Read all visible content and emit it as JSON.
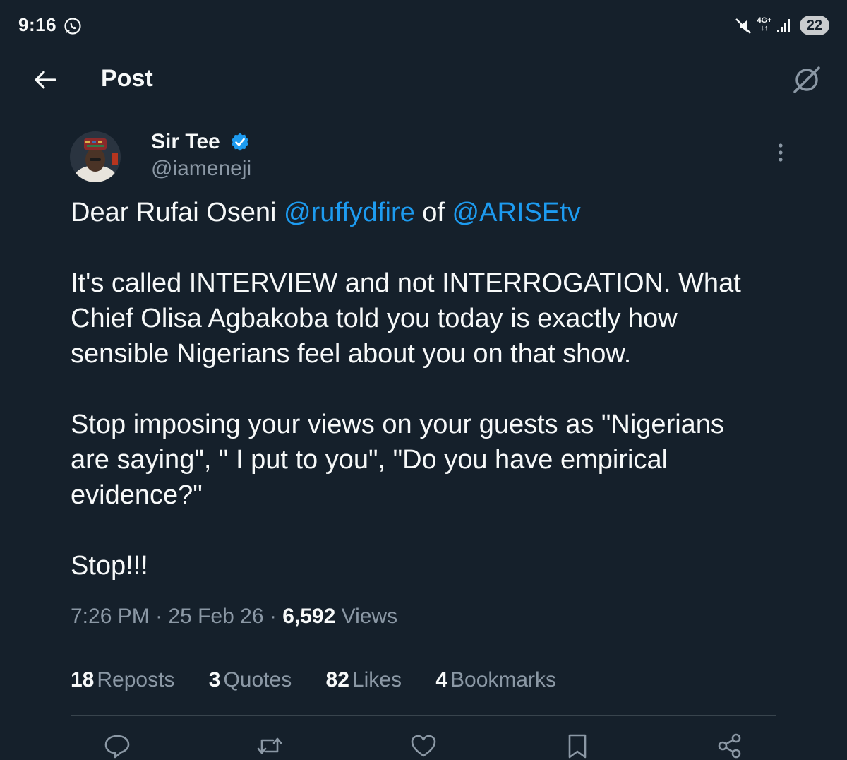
{
  "status_bar": {
    "time": "9:16",
    "network": "4G+",
    "battery": "22"
  },
  "header": {
    "title": "Post"
  },
  "post": {
    "author": {
      "display_name": "Sir Tee",
      "handle": "@iameneji"
    },
    "text": {
      "line1_prefix": "Dear Rufai Oseni ",
      "mention1": "@ruffydfire",
      "line1_mid": " of ",
      "mention2": "@ARISEtv",
      "para2_line1": "It's called INTERVIEW and not INTERROGATION. What",
      "para2_line2": "Chief Olisa Agbakoba told you today is exactly how",
      "para2_line3": "sensible Nigerians feel about you on that show.",
      "para3_line1": "Stop imposing your views on your guests as \"Nigerians",
      "para3_line2": "are saying\", \" I put to you\", \"Do you have empirical",
      "para3_line3": "evidence?\"",
      "para4": "Stop!!!"
    },
    "meta": {
      "time": "7:26 PM",
      "sep1": " · ",
      "date": "25 Feb 26",
      "sep2": " · ",
      "views_count": "6,592",
      "views_label": " Views"
    },
    "stats": {
      "reposts_count": "18",
      "reposts_label": "Reposts",
      "quotes_count": "3",
      "quotes_label": "Quotes",
      "likes_count": "82",
      "likes_label": "Likes",
      "bookmarks_count": "4",
      "bookmarks_label": "Bookmarks"
    }
  },
  "actions": [
    "reply-icon",
    "repost-icon",
    "like-icon",
    "bookmark-icon",
    "share-icon"
  ],
  "colors": {
    "background": "#15202b",
    "text": "#f7f9f9",
    "secondary_text": "#8b98a5",
    "accent": "#1d9bf0",
    "divider": "#38444d"
  }
}
